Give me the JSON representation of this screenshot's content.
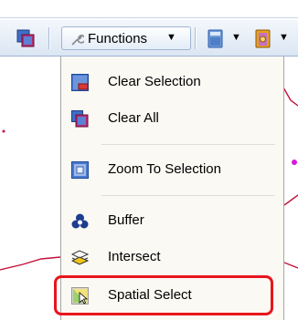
{
  "toolbar": {
    "functions_label": "Functions"
  },
  "menu": {
    "items": [
      {
        "label": "Clear Selection",
        "icon": "clear-selection-icon"
      },
      {
        "label": "Clear All",
        "icon": "clear-all-icon"
      },
      {
        "label": "Zoom To Selection",
        "icon": "zoom-to-selection-icon"
      },
      {
        "label": "Buffer",
        "icon": "buffer-icon"
      },
      {
        "label": "Intersect",
        "icon": "intersect-icon"
      },
      {
        "label": "Spatial Select",
        "icon": "spatial-select-icon"
      }
    ]
  },
  "colors": {
    "highlight": "#e8141c",
    "map_road": "#c3123d",
    "menu_bg": "#fbf9f3",
    "toolbar_bg": "#dbe6f3"
  }
}
